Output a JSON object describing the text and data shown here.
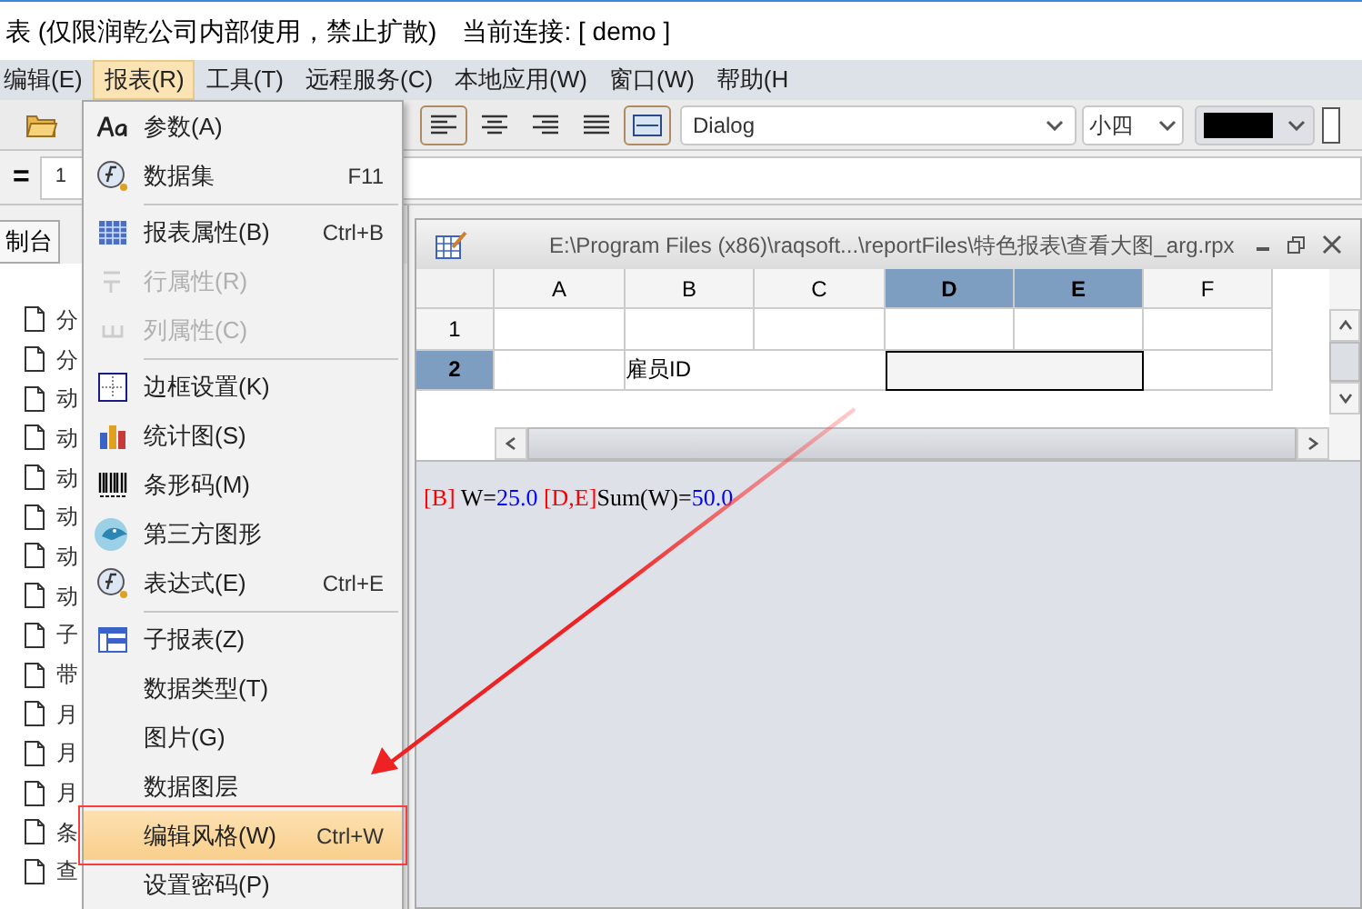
{
  "window": {
    "title": "表 (仅限润乾公司内部使用，禁止扩散)",
    "connection": "当前连接: [ demo ]"
  },
  "menubar": [
    {
      "label": "编辑(E)",
      "selected": false
    },
    {
      "label": "报表(R)",
      "selected": true
    },
    {
      "label": "工具(T)",
      "selected": false
    },
    {
      "label": "远程服务(C)",
      "selected": false
    },
    {
      "label": "本地应用(W)",
      "selected": false
    },
    {
      "label": "窗口(W)",
      "selected": false
    },
    {
      "label": "帮助(H",
      "selected": false
    }
  ],
  "toolbar": {
    "align_buttons": [
      {
        "selected": true
      },
      {
        "selected": false
      },
      {
        "selected": false
      },
      {
        "selected": false
      },
      {
        "selected": true
      }
    ],
    "font": "Dialog",
    "size": "小四"
  },
  "formula_bar": {
    "sign": "=",
    "value": "1"
  },
  "left_panel": {
    "tab": "制台",
    "items": [
      "分",
      "分",
      "动",
      "动",
      "动",
      "动",
      "动",
      "动",
      "子",
      "带",
      "月",
      "月",
      "月",
      "条",
      "查"
    ]
  },
  "menu": [
    {
      "kind": "item",
      "label": "参数(A)",
      "disabled": false,
      "selected": false
    },
    {
      "kind": "item",
      "label": "数据集",
      "shortcut": "F11",
      "disabled": false,
      "selected": false
    },
    {
      "kind": "separator"
    },
    {
      "kind": "item",
      "label": "报表属性(B)",
      "shortcut": "Ctrl+B",
      "disabled": false,
      "selected": false
    },
    {
      "kind": "item",
      "label": "行属性(R)",
      "disabled": true,
      "selected": false
    },
    {
      "kind": "item",
      "label": "列属性(C)",
      "disabled": true,
      "selected": false
    },
    {
      "kind": "separator"
    },
    {
      "kind": "item",
      "label": "边框设置(K)",
      "disabled": false,
      "selected": false
    },
    {
      "kind": "item",
      "label": "统计图(S)",
      "disabled": false,
      "selected": false
    },
    {
      "kind": "item",
      "label": "条形码(M)",
      "disabled": false,
      "selected": false
    },
    {
      "kind": "item",
      "label": "第三方图形",
      "disabled": false,
      "selected": false
    },
    {
      "kind": "item",
      "label": "表达式(E)",
      "shortcut": "Ctrl+E",
      "disabled": false,
      "selected": false
    },
    {
      "kind": "separator"
    },
    {
      "kind": "item",
      "label": "子报表(Z)",
      "disabled": false,
      "selected": false
    },
    {
      "kind": "item",
      "label": "数据类型(T)",
      "disabled": false,
      "selected": false
    },
    {
      "kind": "item",
      "label": "图片(G)",
      "disabled": false,
      "selected": false
    },
    {
      "kind": "item",
      "label": "数据图层",
      "disabled": false,
      "selected": false
    },
    {
      "kind": "item",
      "label": "编辑风格(W)",
      "shortcut": "Ctrl+W",
      "disabled": false,
      "selected": true
    },
    {
      "kind": "item",
      "label": "设置密码(P)",
      "disabled": false,
      "selected": false
    }
  ],
  "document": {
    "title": "E:\\Program Files (x86)\\raqsoft...\\reportFiles\\特色报表\\查看大图_arg.rpx",
    "columns": [
      {
        "label": "A",
        "selected": false
      },
      {
        "label": "B",
        "selected": false
      },
      {
        "label": "C",
        "selected": false
      },
      {
        "label": "D",
        "selected": true
      },
      {
        "label": "E",
        "selected": true
      },
      {
        "label": "F",
        "selected": false
      }
    ],
    "rows": [
      {
        "label": "1",
        "selected": false
      },
      {
        "label": "2",
        "selected": true
      }
    ],
    "cell_b2": "雇员ID",
    "status": [
      {
        "text": "[B]",
        "color": "#ff0000"
      },
      {
        "text": " W=",
        "color": "#000000"
      },
      {
        "text": "25.0",
        "color": "#0000ff"
      },
      {
        "text": " [D,E]",
        "color": "#ff0000"
      },
      {
        "text": "Sum(W)=",
        "color": "#000000"
      },
      {
        "text": "50.0",
        "color": "#0000ff"
      }
    ]
  }
}
